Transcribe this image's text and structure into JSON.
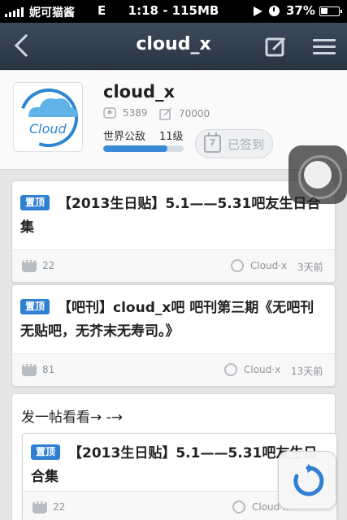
{
  "status_bar": {
    "carrier": "妮可猫酱",
    "network": "E",
    "time": "1:18 - 115MB",
    "battery": "37%"
  },
  "nav": {
    "title": "cloud_x"
  },
  "forum": {
    "name": "cloud_x",
    "members": "5389",
    "posts": "70000",
    "level_title": "世界公敌",
    "level": "11级",
    "level_progress": 0.8,
    "checkin_label": "已签到",
    "calendar_day": "7"
  },
  "threads": [
    {
      "badge": "置顶",
      "title": "【2013生日贴】5.1——5.31吧友生日合集",
      "replies": "22",
      "author": "Cloud·x",
      "time": "3天前"
    },
    {
      "badge": "置顶",
      "title": "【吧刊】cloud_x吧 吧刊第三期《无吧刊无贴吧，无芥末无寿司。》",
      "replies": "81",
      "author": "Cloud·x",
      "time": "13天前"
    }
  ],
  "post_prompt": {
    "text": "发一帖看看→ -→",
    "nested_thread": {
      "badge": "置顶",
      "title": "【2013生日贴】5.1——5.31吧友生日合集",
      "replies": "22",
      "author": "Cloud·x"
    }
  },
  "avatar_text": "Cloud",
  "colors": {
    "nav_bg": "#2f3b4b",
    "accent": "#2f7fd3"
  }
}
